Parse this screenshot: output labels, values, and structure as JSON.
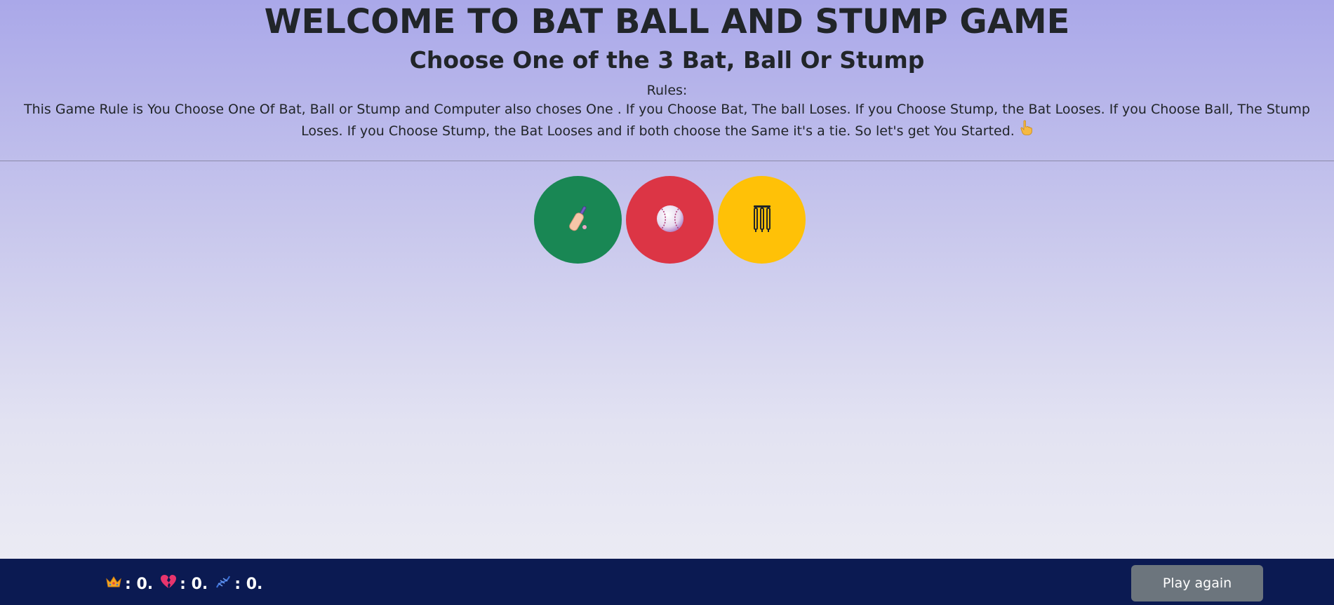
{
  "header": {
    "title": "WELCOME TO BAT BALL AND STUMP GAME",
    "subtitle": "Choose One of the 3 Bat, Ball Or Stump",
    "rules_label": "Rules:",
    "rules_text": "This Game Rule is You Choose One Of Bat, Ball or Stump and Computer also choses One . If you Choose Bat, The ball Loses. If you Choose Stump, the Bat Looses. If you Choose Ball, The Stump Loses. If you Choose Stump, the Bat Looses and if both choose the Same it's a tie. So let's get You Started.",
    "rules_icon": "pointing-up-hand-icon"
  },
  "choices": [
    {
      "name": "bat",
      "icon": "cricket-bat-icon",
      "color": "#198754"
    },
    {
      "name": "ball",
      "icon": "baseball-icon",
      "color": "#dc3545"
    },
    {
      "name": "stump",
      "icon": "wicket-stumps-icon",
      "color": "#ffc107"
    }
  ],
  "footer": {
    "wins_icon": "crown-icon",
    "wins_value": ": 0.",
    "losses_icon": "broken-heart-icon",
    "losses_value": ": 0.",
    "ties_icon": "tie-link-icon",
    "ties_value": ": 0.",
    "play_again_label": "Play again",
    "background_color": "#0b1a52",
    "button_color": "#6c757d"
  }
}
